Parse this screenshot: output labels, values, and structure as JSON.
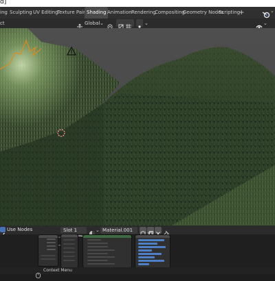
{
  "window": {
    "title_fragment": "d]"
  },
  "workspace_tabs": [
    {
      "label": "ing"
    },
    {
      "label": "Sculpting"
    },
    {
      "label": "UV Editing"
    },
    {
      "label": "Texture Paint"
    },
    {
      "label": "Shading"
    },
    {
      "label": "Animation"
    },
    {
      "label": "Rendering"
    },
    {
      "label": "Compositing"
    },
    {
      "label": "Geometry Nodes"
    },
    {
      "label": "Scripting"
    }
  ],
  "active_tab": "Shading",
  "add_tab_symbol": "+",
  "viewport_header": {
    "mode_fragment": "ct",
    "transform_orientation": "Global"
  },
  "node_editor_header": {
    "use_nodes_label": "Use Nodes",
    "use_nodes_checked": true,
    "slot_label": "Slot 1",
    "material_name": "Material.001"
  },
  "status_bar": {
    "context_menu_label": "Context Menu"
  },
  "colors": {
    "accent_active_tab": "#4a4a4a",
    "checkbox_blue": "#4772b3",
    "grass_dark": "#1c2a1a",
    "grass_light": "#7f9a62",
    "sky": "#4b4b4b",
    "selection_orange": "#e08a1e"
  },
  "icons": [
    "blender-logo-icon",
    "chevron-down-icon",
    "transform-orientation-icon",
    "snap-icon",
    "proportional-editing-icon",
    "overlay-icon",
    "camera-light-icon",
    "3d-cursor-icon",
    "material-sphere-icon",
    "shield-icon",
    "copy-icon",
    "close-icon",
    "pin-icon",
    "mouse-icon"
  ]
}
